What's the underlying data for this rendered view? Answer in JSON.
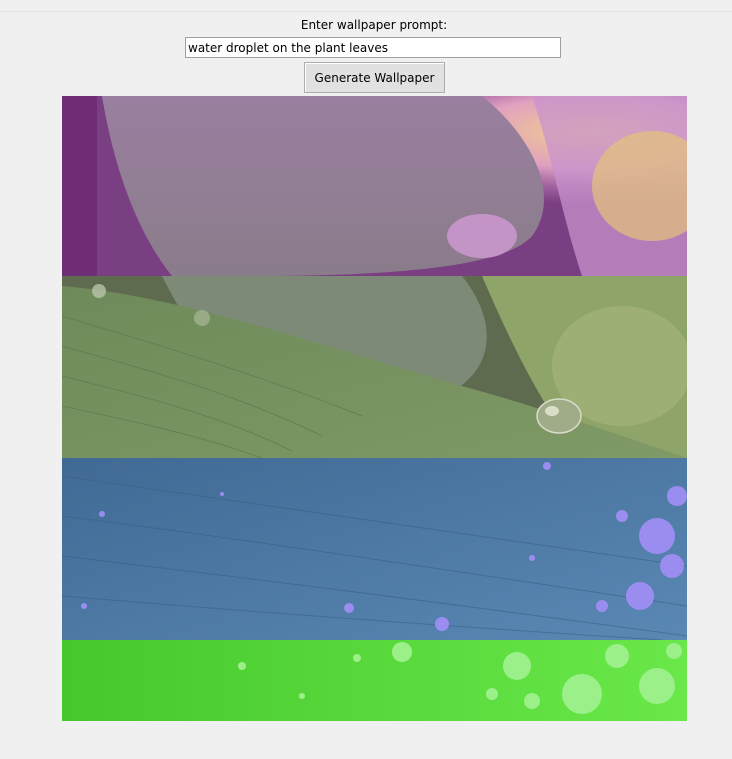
{
  "app": {
    "prompt_label": "Enter wallpaper prompt:",
    "prompt_value": "water droplet on the plant leaves",
    "generate_label": "Generate Wallpaper"
  },
  "wallpaper": {
    "subject": "water droplet on plant leaf",
    "bands": [
      {
        "name": "magenta-tinted band",
        "color": "#b080b0"
      },
      {
        "name": "olive-green-tinted band",
        "color": "#7d9462"
      },
      {
        "name": "blue-tinted band",
        "color": "#4f7fa8"
      },
      {
        "name": "green-tinted band",
        "color": "#4fe030"
      }
    ]
  }
}
